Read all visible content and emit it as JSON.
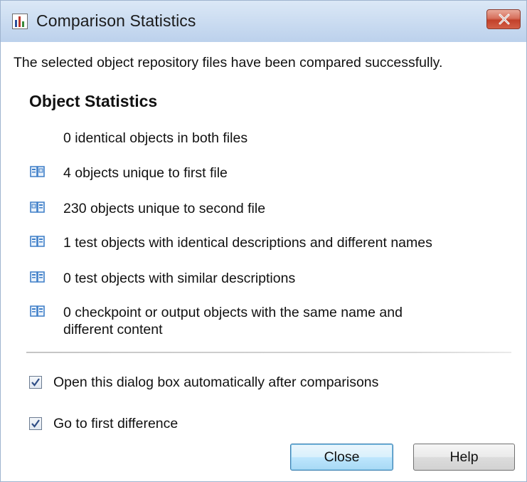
{
  "window": {
    "title": "Comparison Statistics",
    "app_icon": "bar-chart-icon",
    "close_icon": "close-icon"
  },
  "intro_text": "The selected object repository files have been compared successfully.",
  "section_title": "Object Statistics",
  "stats": [
    {
      "text": "0 identical objects in both files",
      "icon": "none"
    },
    {
      "text": "4 objects unique to first file",
      "icon": "repository-first-icon"
    },
    {
      "text": "230 objects unique to second file",
      "icon": "repository-second-icon"
    },
    {
      "text": "1 test objects with identical descriptions and different names",
      "icon": "repository-both-icon"
    },
    {
      "text": "0 test objects with similar descriptions",
      "icon": "repository-both-icon"
    },
    {
      "text_line1": "0 checkpoint or output objects with the same name and",
      "text_line2": "different content",
      "icon": "repository-both-icon"
    }
  ],
  "options": {
    "open_dialog_label": "Open this dialog box automatically after comparisons",
    "open_dialog_checked": true,
    "go_first_label": "Go to first difference",
    "go_first_checked": true
  },
  "buttons": {
    "close_label": "Close",
    "help_label": "Help"
  },
  "colors": {
    "icon_blue": "#3f7fc8",
    "close_red": "#c2412a",
    "default_button_border": "#3c7fb1"
  }
}
